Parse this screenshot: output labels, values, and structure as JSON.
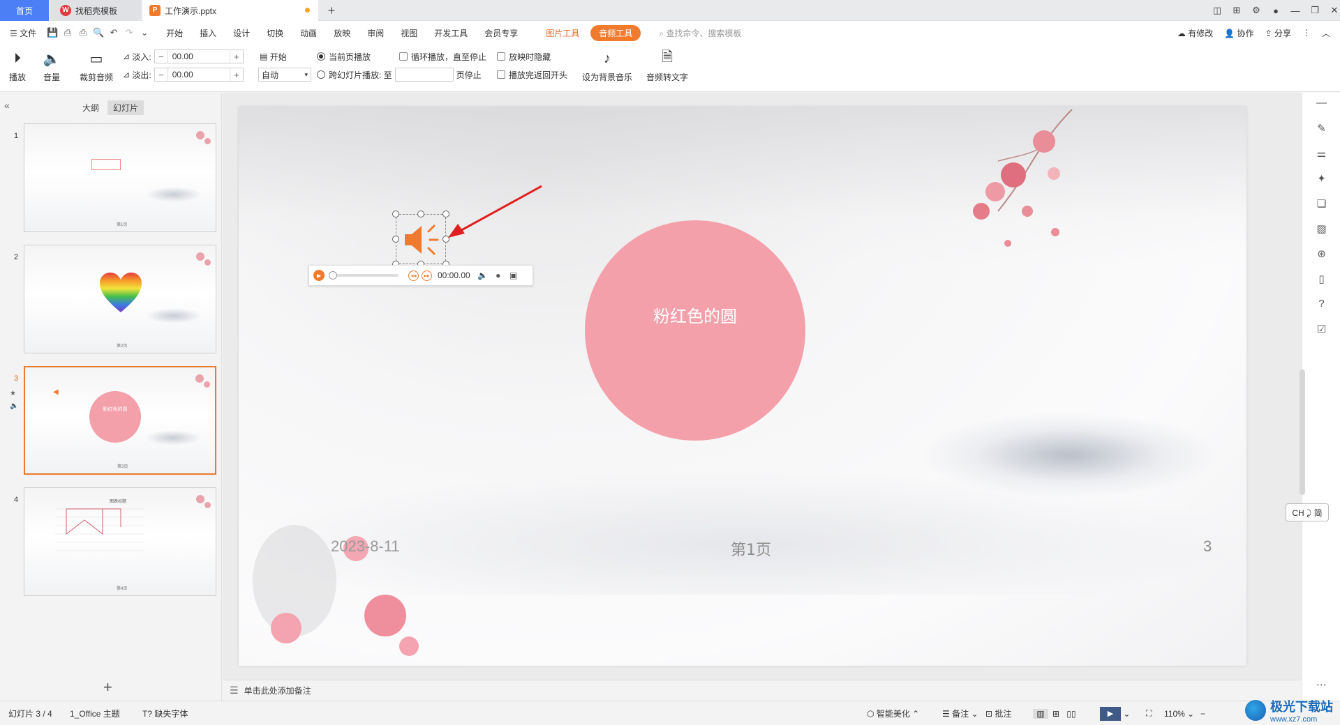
{
  "tabs": {
    "home": "首页",
    "template": "找稻壳模板",
    "document": "工作演示.pptx"
  },
  "menu": {
    "file": "文件",
    "items": [
      "开始",
      "插入",
      "设计",
      "切换",
      "动画",
      "放映",
      "审阅",
      "视图",
      "开发工具",
      "会员专享"
    ],
    "picture_tools": "图片工具",
    "audio_tools": "音频工具",
    "search_placeholder": "查找命令、搜索模板",
    "has_changes": "有修改",
    "collaborate": "协作",
    "share": "分享"
  },
  "ribbon": {
    "play": "播放",
    "volume": "音量",
    "trim": "裁剪音频",
    "fade_in_label": "淡入:",
    "fade_in_value": "00.00",
    "fade_out_label": "淡出:",
    "fade_out_value": "00.00",
    "start_label": "开始",
    "start_value": "自动",
    "current_page_play": "当前页播放",
    "cross_slide_play": "跨幻灯片播放: 至",
    "page_stop": "页停止",
    "loop_play": "循环播放，直至停止",
    "hide_when_playing": "放映时隐藏",
    "rewind_after": "播放完返回开头",
    "set_bg_music": "设为背景音乐",
    "audio_to_text": "音频转文字"
  },
  "left_panel": {
    "outline_tab": "大纲",
    "slides_tab": "幻灯片",
    "slides": [
      {
        "num": "1",
        "title": "第1页"
      },
      {
        "num": "2",
        "title": "第2页"
      },
      {
        "num": "3",
        "title": "第3页",
        "circle_text": "粉红色的圆"
      },
      {
        "num": "4",
        "title": "第4页",
        "chart_title": "图表标题"
      }
    ]
  },
  "slide": {
    "circle_text": "粉红色的圆",
    "date": "2023-8-11",
    "page_label": "第1页",
    "page_number": "3"
  },
  "audio_player": {
    "time": "00:00.00",
    "progress": 0
  },
  "notes": {
    "placeholder": "单击此处添加备注"
  },
  "ime": {
    "label": "CH ⤸ 简"
  },
  "status": {
    "slide_index": "幻灯片 3 / 4",
    "theme": "1_Office 主题",
    "missing_fonts": "缺失字体",
    "smart_beautify": "智能美化",
    "notes": "备注",
    "comments": "批注",
    "zoom": "110%"
  },
  "watermark": {
    "title": "极光下载站",
    "url": "www.xz7.com"
  },
  "colors": {
    "accent_orange": "#f07a2d",
    "circle_pink": "#f4a0ab",
    "home_tab_blue": "#4c7ef6",
    "annotation_arrow_red": "#e02020"
  }
}
